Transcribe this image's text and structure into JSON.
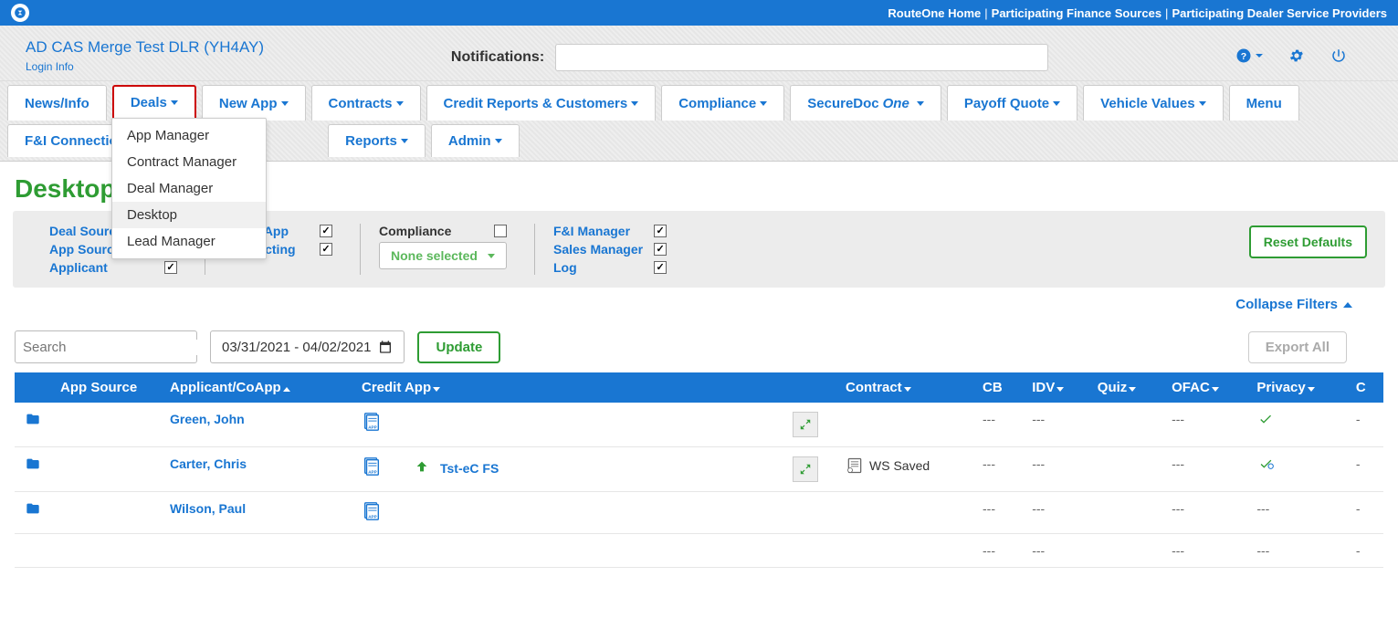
{
  "top_links": {
    "home": "RouteOne Home",
    "pfs": "Participating Finance Sources",
    "pdsp": "Participating Dealer Service Providers"
  },
  "header": {
    "dealer_name": "AD CAS Merge Test DLR (YH4AY)",
    "login_info": "Login Info",
    "notifications_label": "Notifications:"
  },
  "nav": {
    "news": "News/Info",
    "deals": "Deals",
    "new_app": "New App",
    "contracts": "Contracts",
    "credit_reports": "Credit Reports & Customers",
    "compliance": "Compliance",
    "securedoc": "SecureDocOne",
    "payoff_quote": "Payoff Quote",
    "vehicle_values": "Vehicle Values",
    "menu": "Menu",
    "fi_connections": "F&I Connections",
    "reports": "Reports",
    "admin": "Admin"
  },
  "deals_dropdown": {
    "app_manager": "App Manager",
    "contract_manager": "Contract Manager",
    "deal_manager": "Deal Manager",
    "desktop": "Desktop",
    "lead_manager": "Lead Manager"
  },
  "page_title": "Desktop",
  "filters": {
    "deal_source": "Deal Source",
    "app_source": "App Source",
    "applicant": "Applicant",
    "credit_app": "Credit App",
    "contracting": "Contracting",
    "compliance": "Compliance",
    "none_selected": "None selected",
    "fi_manager": "F&I Manager",
    "sales_manager": "Sales Manager",
    "log": "Log",
    "reset_defaults": "Reset Defaults",
    "collapse": "Collapse Filters"
  },
  "toolbar": {
    "search_placeholder": "Search",
    "date_range": "03/31/2021 - 04/02/2021",
    "update": "Update",
    "export_all": "Export All"
  },
  "table": {
    "headers": {
      "app_source": "App Source",
      "applicant": "Applicant/CoApp",
      "credit_app": "Credit App",
      "contract": "Contract",
      "cb": "CB",
      "idv": "IDV",
      "quiz": "Quiz",
      "ofac": "OFAC",
      "privacy": "Privacy",
      "c": "C"
    },
    "rows": [
      {
        "applicant": "Green, John",
        "credit_app_text": "",
        "contract_text": "",
        "cb": "---",
        "idv": "---",
        "quiz": "",
        "ofac": "---",
        "privacy": "check",
        "c": "-",
        "has_expand": true,
        "has_arrow": false,
        "has_ws_icon": false
      },
      {
        "applicant": "Carter, Chris",
        "credit_app_text": "Tst-eC FS",
        "contract_text": "WS Saved",
        "cb": "---",
        "idv": "---",
        "quiz": "",
        "ofac": "---",
        "privacy": "check-blue",
        "c": "-",
        "has_expand": true,
        "has_arrow": true,
        "has_ws_icon": true
      },
      {
        "applicant": "Wilson, Paul",
        "credit_app_text": "",
        "contract_text": "",
        "cb": "---",
        "idv": "---",
        "quiz": "",
        "ofac": "---",
        "privacy": "---",
        "c": "-",
        "has_expand": false,
        "has_arrow": false,
        "has_ws_icon": false
      }
    ],
    "extra_row": {
      "cb": "---",
      "idv": "---",
      "quiz": "",
      "ofac": "---",
      "privacy": "---",
      "c": "-"
    }
  }
}
